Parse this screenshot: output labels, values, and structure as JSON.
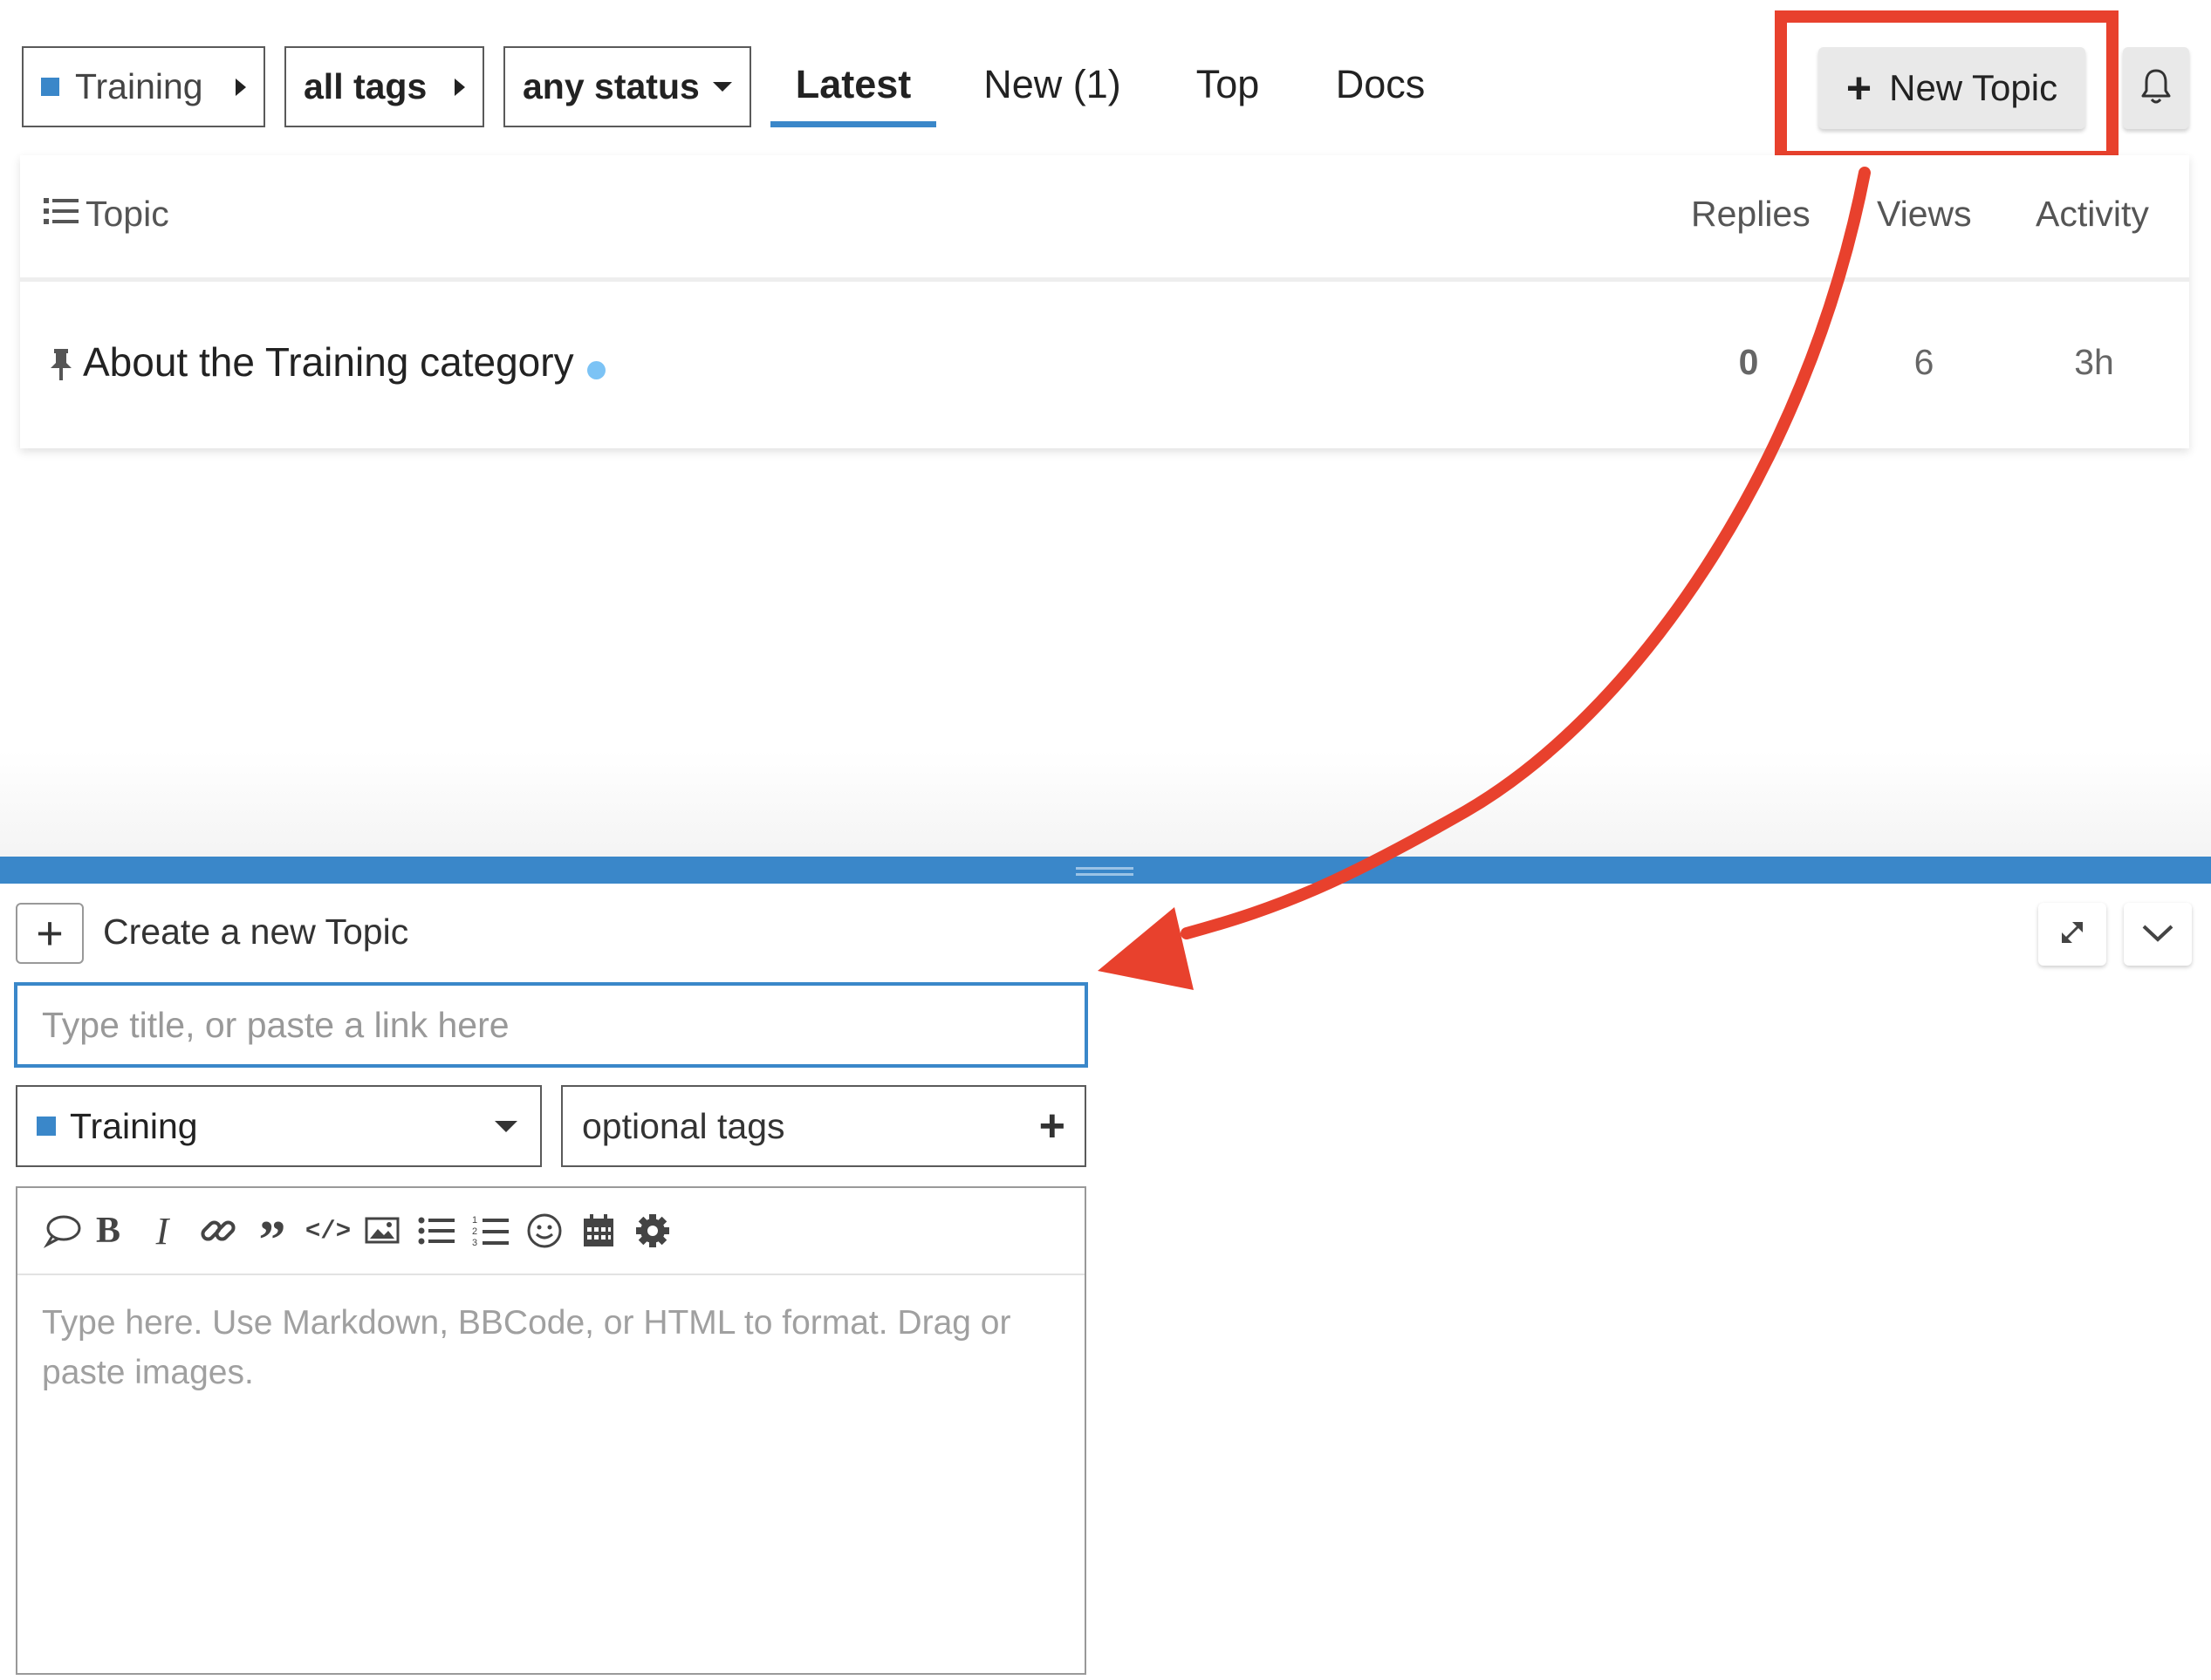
{
  "nav": {
    "category_dropdown": "Training",
    "tags_dropdown": "all tags",
    "status_dropdown": "any status",
    "tabs": [
      {
        "label": "Latest",
        "active": true
      },
      {
        "label": "New (1)",
        "active": false
      },
      {
        "label": "Top",
        "active": false
      },
      {
        "label": "Docs",
        "active": false
      }
    ],
    "new_topic_label": "New Topic",
    "bell_icon": "bell-icon"
  },
  "topic_list": {
    "headers": {
      "topic": "Topic",
      "replies": "Replies",
      "views": "Views",
      "activity": "Activity"
    },
    "rows": [
      {
        "title": "About the Training category",
        "pinned": true,
        "unread": true,
        "replies": "0",
        "views": "6",
        "activity": "3h"
      }
    ]
  },
  "composer": {
    "action_label": "Create a new Topic",
    "title_placeholder": "Type title, or paste a link here",
    "category": "Training",
    "tags_placeholder": "optional tags",
    "editor_placeholder": "Type here. Use Markdown, BBCode, or HTML to format. Drag or paste images.",
    "toolbar_icons": [
      "speech-bubble-icon",
      "bold-icon",
      "italic-icon",
      "link-icon",
      "quote-icon",
      "code-icon",
      "image-icon",
      "bullet-list-icon",
      "numbered-list-icon",
      "emoji-icon",
      "calendar-icon",
      "gear-icon"
    ]
  },
  "colors": {
    "accent": "#3a87c9",
    "annotation": "#e8412d",
    "unread_dot": "#7cc3f5"
  }
}
